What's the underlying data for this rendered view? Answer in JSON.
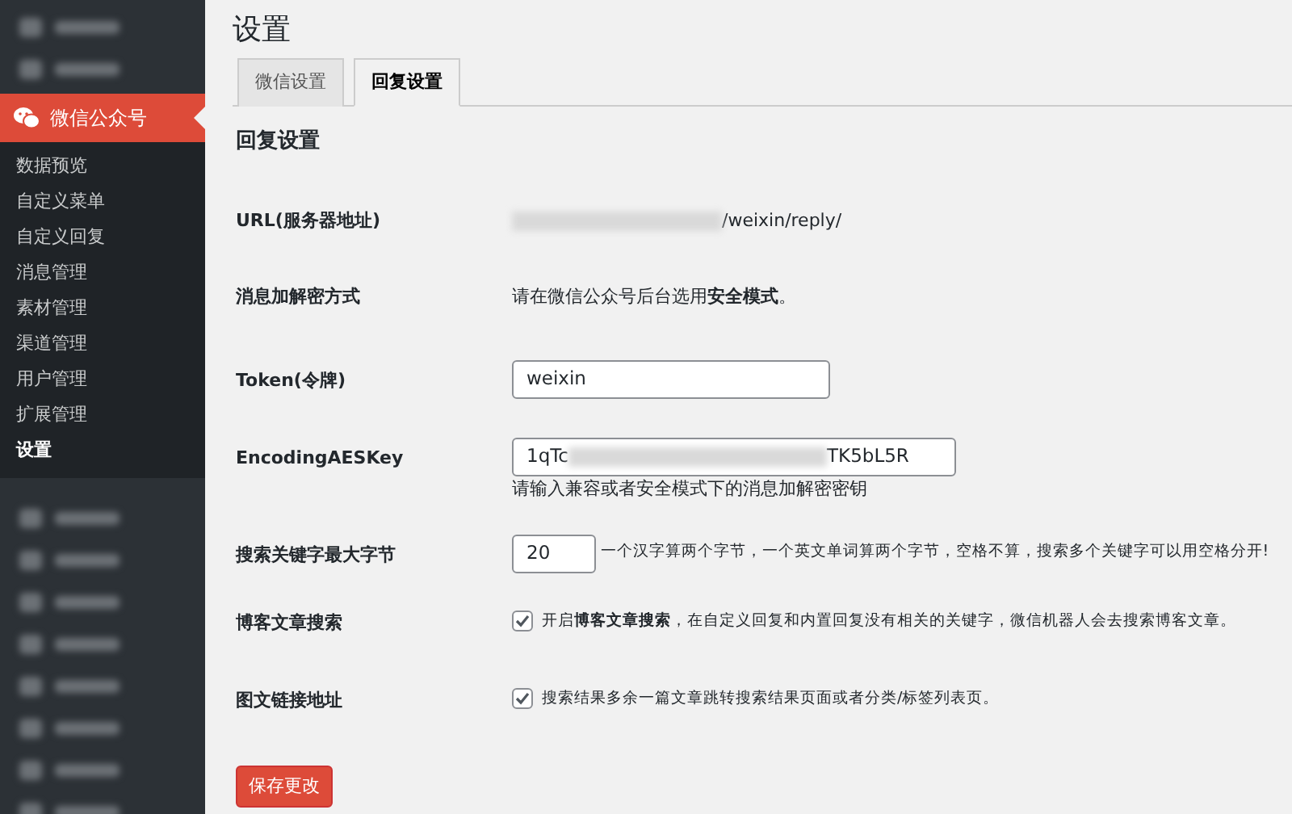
{
  "sidebar": {
    "items_before": [
      {
        "obscured": true
      },
      {
        "obscured": true
      }
    ],
    "active_menu": {
      "label": "微信公众号",
      "selected": true
    },
    "submenu": [
      {
        "label": "数据预览",
        "selected": false
      },
      {
        "label": "自定义菜单",
        "selected": false
      },
      {
        "label": "自定义回复",
        "selected": false
      },
      {
        "label": "消息管理",
        "selected": false
      },
      {
        "label": "素材管理",
        "selected": false
      },
      {
        "label": "渠道管理",
        "selected": false
      },
      {
        "label": "用户管理",
        "selected": false
      },
      {
        "label": "扩展管理",
        "selected": false
      },
      {
        "label": "设置",
        "selected": true
      }
    ],
    "items_after": [
      {
        "obscured": true
      },
      {
        "obscured": true
      },
      {
        "obscured": true
      },
      {
        "obscured": true
      },
      {
        "obscured": true
      },
      {
        "obscured": true
      },
      {
        "obscured": true
      },
      {
        "obscured": true
      }
    ]
  },
  "page_title": "设置",
  "tabs": [
    {
      "label": "微信设置",
      "selected": false
    },
    {
      "label": "回复设置",
      "selected": true
    }
  ],
  "section_title": "回复设置",
  "fields": [
    {
      "kind": "url",
      "label": "URL(服务器地址)",
      "value_end": "/weixin/reply/"
    },
    {
      "kind": "note",
      "label": "消息加解密方式",
      "text": "请在微信公众号后台选用**安全模式**。"
    },
    {
      "kind": "text",
      "label": "Token(令牌)",
      "value": "weixin"
    },
    {
      "kind": "secret",
      "label": "EncodingAESKey",
      "value_start": "1qTc",
      "value_end": "TK5bL5R",
      "help": "请输入兼容或者安全模式下的消息加解密密钥"
    },
    {
      "kind": "number",
      "label": "搜索关键字最大字节",
      "value": "20",
      "help": "一个汉字算两个字节，一个英文单词算两个字节，空格不算，搜索多个关键字可以用空格分开!"
    },
    {
      "kind": "checkbox",
      "label": "博客文章搜索",
      "checked": true,
      "text": "开启**博客文章搜索**，在自定义回复和内置回复没有相关的关键字，微信机器人会去搜索博客文章。"
    },
    {
      "kind": "checkbox",
      "label": "图文链接地址",
      "checked": true,
      "text": "搜索结果多余一篇文章跳转搜索结果页面或者分类/标签列表页。"
    }
  ],
  "save_button": "保存更改"
}
